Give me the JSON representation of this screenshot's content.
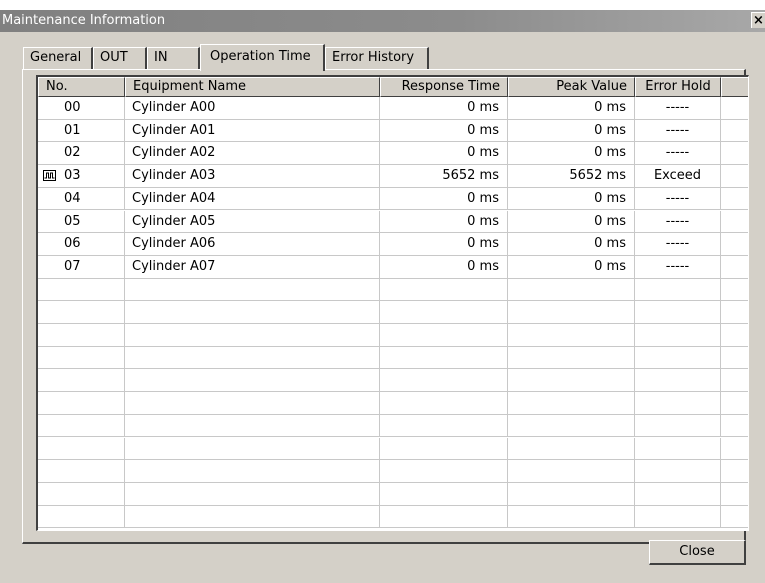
{
  "window": {
    "title": "Maintenance Information",
    "close_glyph": "×"
  },
  "tabs": [
    {
      "label": "General"
    },
    {
      "label": "OUT"
    },
    {
      "label": "IN"
    },
    {
      "label": "Operation Time"
    },
    {
      "label": "Error History"
    }
  ],
  "active_tab": "Operation Time",
  "table": {
    "columns": [
      "No.",
      "Equipment Name",
      "Response Time",
      "Peak Value",
      "Error Hold"
    ],
    "rows": [
      {
        "no": "00",
        "name": "Cylinder A00",
        "response": "0 ms",
        "peak": "0 ms",
        "hold": "-----"
      },
      {
        "no": "01",
        "name": "Cylinder A01",
        "response": "0 ms",
        "peak": "0 ms",
        "hold": "-----"
      },
      {
        "no": "02",
        "name": "Cylinder A02",
        "response": "0 ms",
        "peak": "0 ms",
        "hold": "-----"
      },
      {
        "no": "03",
        "name": "Cylinder A03",
        "response": "5652 ms",
        "peak": "5652 ms",
        "hold": "Exceed",
        "icon": "pulse-waveform-icon"
      },
      {
        "no": "04",
        "name": "Cylinder A04",
        "response": "0 ms",
        "peak": "0 ms",
        "hold": "-----"
      },
      {
        "no": "05",
        "name": "Cylinder A05",
        "response": "0 ms",
        "peak": "0 ms",
        "hold": "-----"
      },
      {
        "no": "06",
        "name": "Cylinder A06",
        "response": "0 ms",
        "peak": "0 ms",
        "hold": "-----"
      },
      {
        "no": "07",
        "name": "Cylinder A07",
        "response": "0 ms",
        "peak": "0 ms",
        "hold": "-----"
      }
    ]
  },
  "buttons": {
    "close_label": "Close"
  }
}
